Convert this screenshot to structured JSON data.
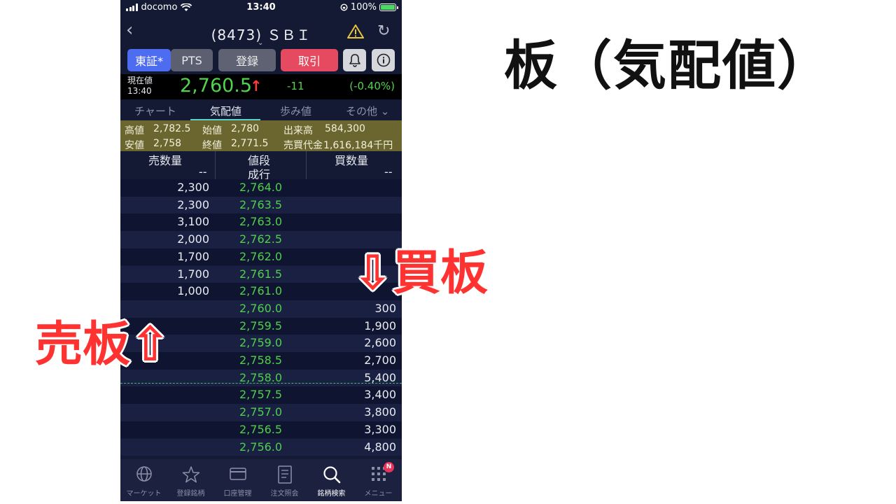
{
  "status_bar": {
    "carrier": "docomo",
    "time": "13:40",
    "battery": "100%"
  },
  "nav": {
    "title": "(8473) ＳＢＩ"
  },
  "buttons": {
    "tosho": "東証*",
    "pts": "PTS",
    "register": "登録",
    "trade": "取引"
  },
  "price": {
    "label1": "現在値",
    "label2": "13:40",
    "value": "2,760.5",
    "arrow": "↑",
    "change": "-11",
    "change_pct": "(-0.40%)"
  },
  "tabs": {
    "chart": "チャート",
    "board": "気配値",
    "steps": "歩み値",
    "other": "その他 ⌄"
  },
  "stats": {
    "high_label": "高値",
    "high": "2,782.5",
    "open_label": "始値",
    "open": "2,780",
    "volume_label": "出来高",
    "volume": "584,300",
    "low_label": "安値",
    "low": "2,758",
    "close_label": "終値",
    "close": "2,771.5",
    "turnover_label": "売買代金",
    "turnover": "1,616,184千円"
  },
  "book_header": {
    "sell": "売数量",
    "price": "値段",
    "buy": "買数量",
    "sell_dash": "--",
    "market": "成行",
    "buy_dash": "--"
  },
  "book_rows": [
    {
      "sell": "2,300",
      "price": "2,764.0",
      "buy": ""
    },
    {
      "sell": "2,300",
      "price": "2,763.5",
      "buy": ""
    },
    {
      "sell": "3,100",
      "price": "2,763.0",
      "buy": ""
    },
    {
      "sell": "2,000",
      "price": "2,762.5",
      "buy": ""
    },
    {
      "sell": "1,700",
      "price": "2,762.0",
      "buy": ""
    },
    {
      "sell": "1,700",
      "price": "2,761.5",
      "buy": ""
    },
    {
      "sell": "1,000",
      "price": "2,761.0",
      "buy": ""
    },
    {
      "sell": "",
      "price": "2,760.0",
      "buy": "300"
    },
    {
      "sell": "",
      "price": "2,759.5",
      "buy": "1,900"
    },
    {
      "sell": "",
      "price": "2,759.0",
      "buy": "2,600"
    },
    {
      "sell": "",
      "price": "2,758.5",
      "buy": "2,700"
    },
    {
      "sell": "",
      "price": "2,758.0",
      "buy": "5,400"
    },
    {
      "sell": "",
      "price": "2,757.5",
      "buy": "3,400"
    },
    {
      "sell": "",
      "price": "2,757.0",
      "buy": "3,800"
    },
    {
      "sell": "",
      "price": "2,756.5",
      "buy": "3,300"
    },
    {
      "sell": "",
      "price": "2,756.0",
      "buy": "4,800"
    }
  ],
  "bottom_nav": [
    {
      "label": "マーケット",
      "icon": "globe-icon"
    },
    {
      "label": "登録銘柄",
      "icon": "star-icon"
    },
    {
      "label": "口座管理",
      "icon": "card-icon"
    },
    {
      "label": "注文照会",
      "icon": "document-icon"
    },
    {
      "label": "銘柄検索",
      "icon": "search-icon"
    },
    {
      "label": "メニュー",
      "icon": "grid-icon"
    }
  ],
  "menu_badge": "N",
  "annotations": {
    "title": "板（気配値）",
    "ask": "売板⇧",
    "bid": "⇩買板"
  },
  "colors": {
    "price_up": "#52d24f",
    "tab_active": "#5ad1c9",
    "trade": "#e64a60",
    "tosho": "#4e6cf0",
    "callout": "#ff3232"
  }
}
